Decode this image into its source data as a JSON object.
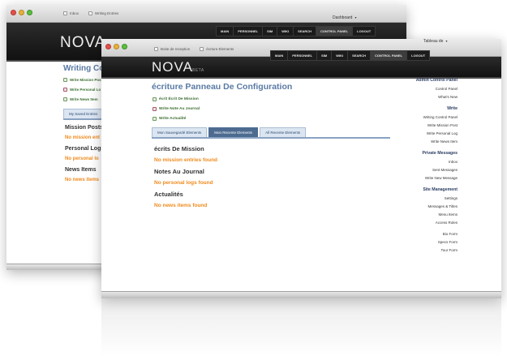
{
  "back_window": {
    "tabs": [
      {
        "label": "Inbox",
        "icon": "page-icon"
      },
      {
        "label": "Writing Entries",
        "icon": "page-icon"
      }
    ],
    "user_menu": "Dashboard",
    "nav": [
      "Main",
      "Personnel",
      "Sim",
      "Wiki",
      "Search",
      "Control Panel",
      "Logout"
    ],
    "active_nav": 5,
    "page_title": "Writing Co",
    "actions": [
      {
        "label": "Write Mission Pos",
        "icon": "page-icon"
      },
      {
        "label": "Write Personal Lo",
        "icon": "note-icon"
      },
      {
        "label": "Write News Item",
        "icon": "page-icon"
      }
    ],
    "tab": "My Saved Entries",
    "sections": [
      {
        "title": "Mission Posts",
        "empty": "No mission ent"
      },
      {
        "title": "Personal Logs",
        "empty": "No personal lo"
      },
      {
        "title": "News Items",
        "empty": "No news items"
      }
    ]
  },
  "front_window": {
    "tabs": [
      {
        "label": "Boite de reception",
        "icon": "page-icon"
      },
      {
        "label": "écrture Elements",
        "icon": "page-icon"
      }
    ],
    "user_menu": "Tableau de",
    "nav": [
      "Main",
      "Personnel",
      "Sim",
      "Wiki",
      "Search",
      "Control Panel",
      "Logout"
    ],
    "active_nav": 5,
    "logo": "NOVA",
    "logo_badge": "BETA",
    "page_title": "écriture Panneau De Configuration",
    "actions": [
      {
        "label": "écrit Écrit De Mission",
        "icon": "page-icon"
      },
      {
        "label": "Write Note Au Journal",
        "icon": "note-icon"
      },
      {
        "label": "Write Actualité",
        "icon": "page-icon"
      }
    ],
    "content_tabs": [
      "Mon Sauvegardé Elements",
      "Mon Recente Elements",
      "All Recente Elements"
    ],
    "active_tab": 1,
    "sections": [
      {
        "title": "écrits De Mission",
        "empty": "No mission entries found"
      },
      {
        "title": "Notes Au Journal",
        "empty": "No personal logs found"
      },
      {
        "title": "Actualités",
        "empty": "No news items found"
      }
    ],
    "sidebar": [
      {
        "heading": "Admin Control Panel",
        "links": [
          "Control Panel",
          "What's New"
        ]
      },
      {
        "heading": "Write",
        "links": [
          "Writing Control Panel",
          "Write Mission Post",
          "Write Personal Log",
          "Write News Item"
        ]
      },
      {
        "heading": "Private Messages",
        "links": [
          "Inbox",
          "Sent Messages",
          "Write New Message"
        ]
      },
      {
        "heading": "Site Management",
        "links": [
          "Settings",
          "Messages & Titles",
          "Menu Items",
          "Access Roles"
        ]
      },
      {
        "heading": "",
        "links": [
          "Bio Form",
          "Specs Form",
          "Tour Form"
        ]
      }
    ]
  },
  "colors": {
    "header_bg": "#1a1a1a",
    "title_blue": "#5a7aa5",
    "empty_orange": "#f08a1c",
    "action_green": "#3b6e2f",
    "tab_active": "#4d6b90"
  }
}
